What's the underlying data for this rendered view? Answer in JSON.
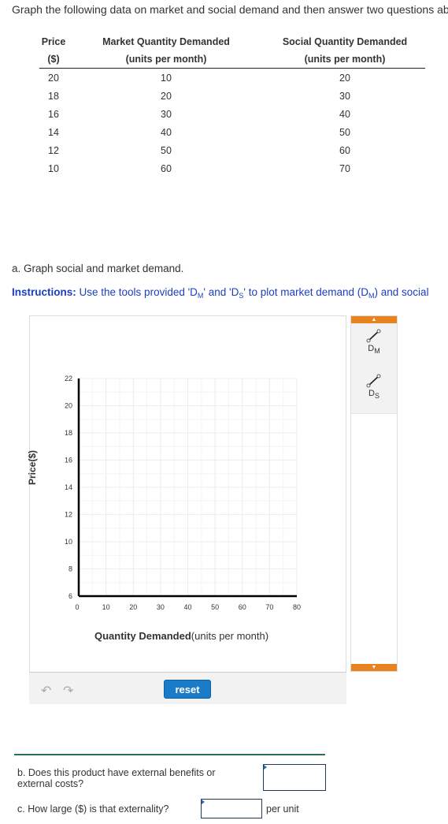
{
  "intro": "Graph the following data on market and social demand and then answer two questions ab",
  "table": {
    "headers": [
      "Price",
      "Market Quantity Demanded",
      "Social Quantity Demanded"
    ],
    "subheaders": [
      "($)",
      "(units per month)",
      "(units per month)"
    ],
    "rows": [
      [
        "20",
        "10",
        "20"
      ],
      [
        "18",
        "20",
        "30"
      ],
      [
        "16",
        "30",
        "40"
      ],
      [
        "14",
        "40",
        "50"
      ],
      [
        "12",
        "50",
        "60"
      ],
      [
        "10",
        "60",
        "70"
      ]
    ]
  },
  "part_a": {
    "question": "a. Graph social and market demand.",
    "instructions_label": "Instructions:",
    "instructions_text_1": " Use the tools provided 'D",
    "sub_m": "M",
    "instructions_text_2": "' and 'D",
    "sub_s": "S",
    "instructions_text_3": "' to plot market demand (D",
    "instructions_text_4": ") and social"
  },
  "graph": {
    "ylabel": "Price($)",
    "xlabel_bold": "Quantity Demanded",
    "xlabel_rest": "(units per month)",
    "yticks": [
      "22",
      "20",
      "18",
      "16",
      "14",
      "12",
      "10",
      "8",
      "6"
    ],
    "xticks": [
      "0",
      "10",
      "20",
      "30",
      "40",
      "50",
      "60",
      "70",
      "80"
    ],
    "ymin": 6,
    "ymax": 22,
    "xmin": 0,
    "xmax": 80
  },
  "tools": [
    {
      "icon": "line-tool-icon",
      "label": "D",
      "sub": "M"
    },
    {
      "icon": "line-tool-icon",
      "label": "D",
      "sub": "S"
    }
  ],
  "sidebar": {
    "scroll_up": "▲",
    "scroll_down": "▼"
  },
  "toolbar": {
    "undo": "↶",
    "redo": "↷",
    "reset_label": "reset"
  },
  "part_b": {
    "question": "b. Does this product have external benefits or external costs?",
    "value": ""
  },
  "part_c": {
    "question": "c. How large ($) is that externality?",
    "value": "",
    "unit": "per unit"
  },
  "colors": {
    "accent_orange": "#e8821e",
    "button_blue": "#1a7bc9",
    "instructions_blue": "#1c3fbf",
    "divider_green": "#2a6e55"
  },
  "chart_data": {
    "type": "line",
    "title": "",
    "xlabel": "Quantity Demanded(units per month)",
    "ylabel": "Price($)",
    "xlim": [
      0,
      80
    ],
    "ylim": [
      6,
      22
    ],
    "x_ticks": [
      0,
      10,
      20,
      30,
      40,
      50,
      60,
      70,
      80
    ],
    "y_ticks": [
      6,
      8,
      10,
      12,
      14,
      16,
      18,
      20,
      22
    ],
    "grid": true,
    "series": []
  }
}
